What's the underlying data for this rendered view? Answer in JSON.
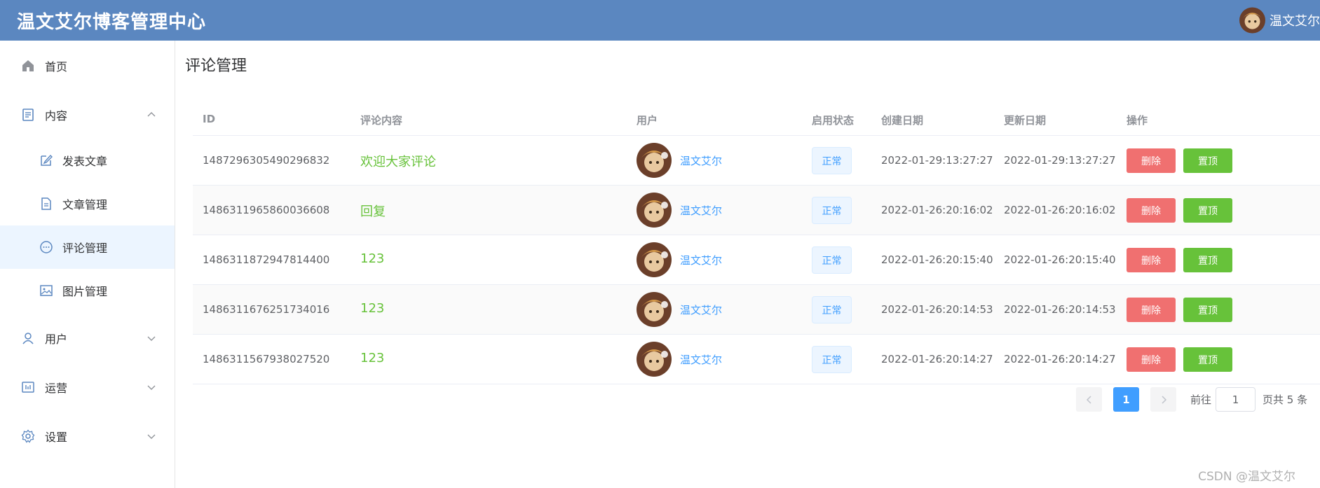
{
  "header": {
    "brand": "温文艾尔博客管理中心",
    "username": "温文艾尔"
  },
  "sidebar": {
    "items": [
      {
        "label": "首页",
        "icon": "home-icon"
      },
      {
        "label": "内容",
        "icon": "document-icon",
        "expanded": true
      },
      {
        "label": "发表文章",
        "icon": "edit-icon"
      },
      {
        "label": "文章管理",
        "icon": "file-icon"
      },
      {
        "label": "评论管理",
        "icon": "comment-icon",
        "active": true
      },
      {
        "label": "图片管理",
        "icon": "picture-icon"
      },
      {
        "label": "用户",
        "icon": "user-icon"
      },
      {
        "label": "运营",
        "icon": "operation-icon"
      },
      {
        "label": "设置",
        "icon": "gear-icon"
      }
    ]
  },
  "page": {
    "title": "评论管理"
  },
  "table": {
    "columns": [
      "ID",
      "评论内容",
      "用户",
      "启用状态",
      "创建日期",
      "更新日期",
      "操作"
    ],
    "rows": [
      {
        "id": "1487296305490296832",
        "content": "欢迎大家评论",
        "user": "温文艾尔",
        "status": "正常",
        "created": "2022-01-29:13:27:27",
        "updated": "2022-01-29:13:27:27"
      },
      {
        "id": "1486311965860036608",
        "content": "回复",
        "user": "温文艾尔",
        "status": "正常",
        "created": "2022-01-26:20:16:02",
        "updated": "2022-01-26:20:16:02"
      },
      {
        "id": "1486311872947814400",
        "content": "123",
        "user": "温文艾尔",
        "status": "正常",
        "created": "2022-01-26:20:15:40",
        "updated": "2022-01-26:20:15:40"
      },
      {
        "id": "1486311676251734016",
        "content": "123",
        "user": "温文艾尔",
        "status": "正常",
        "created": "2022-01-26:20:14:53",
        "updated": "2022-01-26:20:14:53"
      },
      {
        "id": "1486311567938027520",
        "content": "123",
        "user": "温文艾尔",
        "status": "正常",
        "created": "2022-01-26:20:14:27",
        "updated": "2022-01-26:20:14:27"
      }
    ],
    "delete_label": "删除",
    "pin_label": "置顶"
  },
  "pagination": {
    "current": "1",
    "goto_label": "前往",
    "goto_value": "1",
    "total_label": "页共 5 条"
  },
  "watermark": "CSDN @温文艾尔",
  "colors": {
    "header": "#5b87c0",
    "primary": "#409eff",
    "success": "#67c23a",
    "danger": "#f07070"
  }
}
